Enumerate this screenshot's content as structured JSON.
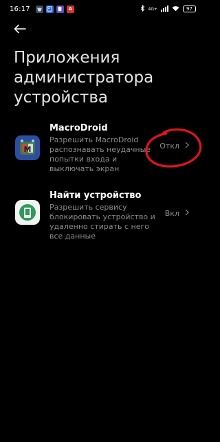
{
  "status_bar": {
    "time": "16:17",
    "signal_text": "4G+",
    "battery": "97",
    "icons": [
      "bug-app-icon",
      "gallery-icon",
      "device-icon",
      "red-app-icon",
      "bluetooth-icon",
      "signal-icon",
      "wifi-icon",
      "battery-icon"
    ]
  },
  "header": {
    "back_icon": "arrow-left-icon",
    "title": "Приложения администратора устройства"
  },
  "apps": [
    {
      "name": "MacroDroid",
      "description": "Разрешить MacroDroid распознавать неудачные попытки входа и выключать экран",
      "status": "Откл",
      "icon": "macrodroid-icon"
    },
    {
      "name": "Найти устройство",
      "description": "Разрешить сервису блокировать устройство и удаленно стирать с него все данные",
      "status": "Вкл",
      "icon": "find-device-icon"
    }
  ],
  "colors": {
    "background": "#000000",
    "title": "#e6e6e6",
    "secondary_text": "#8c8c8c",
    "annotation": "#e0141e"
  }
}
